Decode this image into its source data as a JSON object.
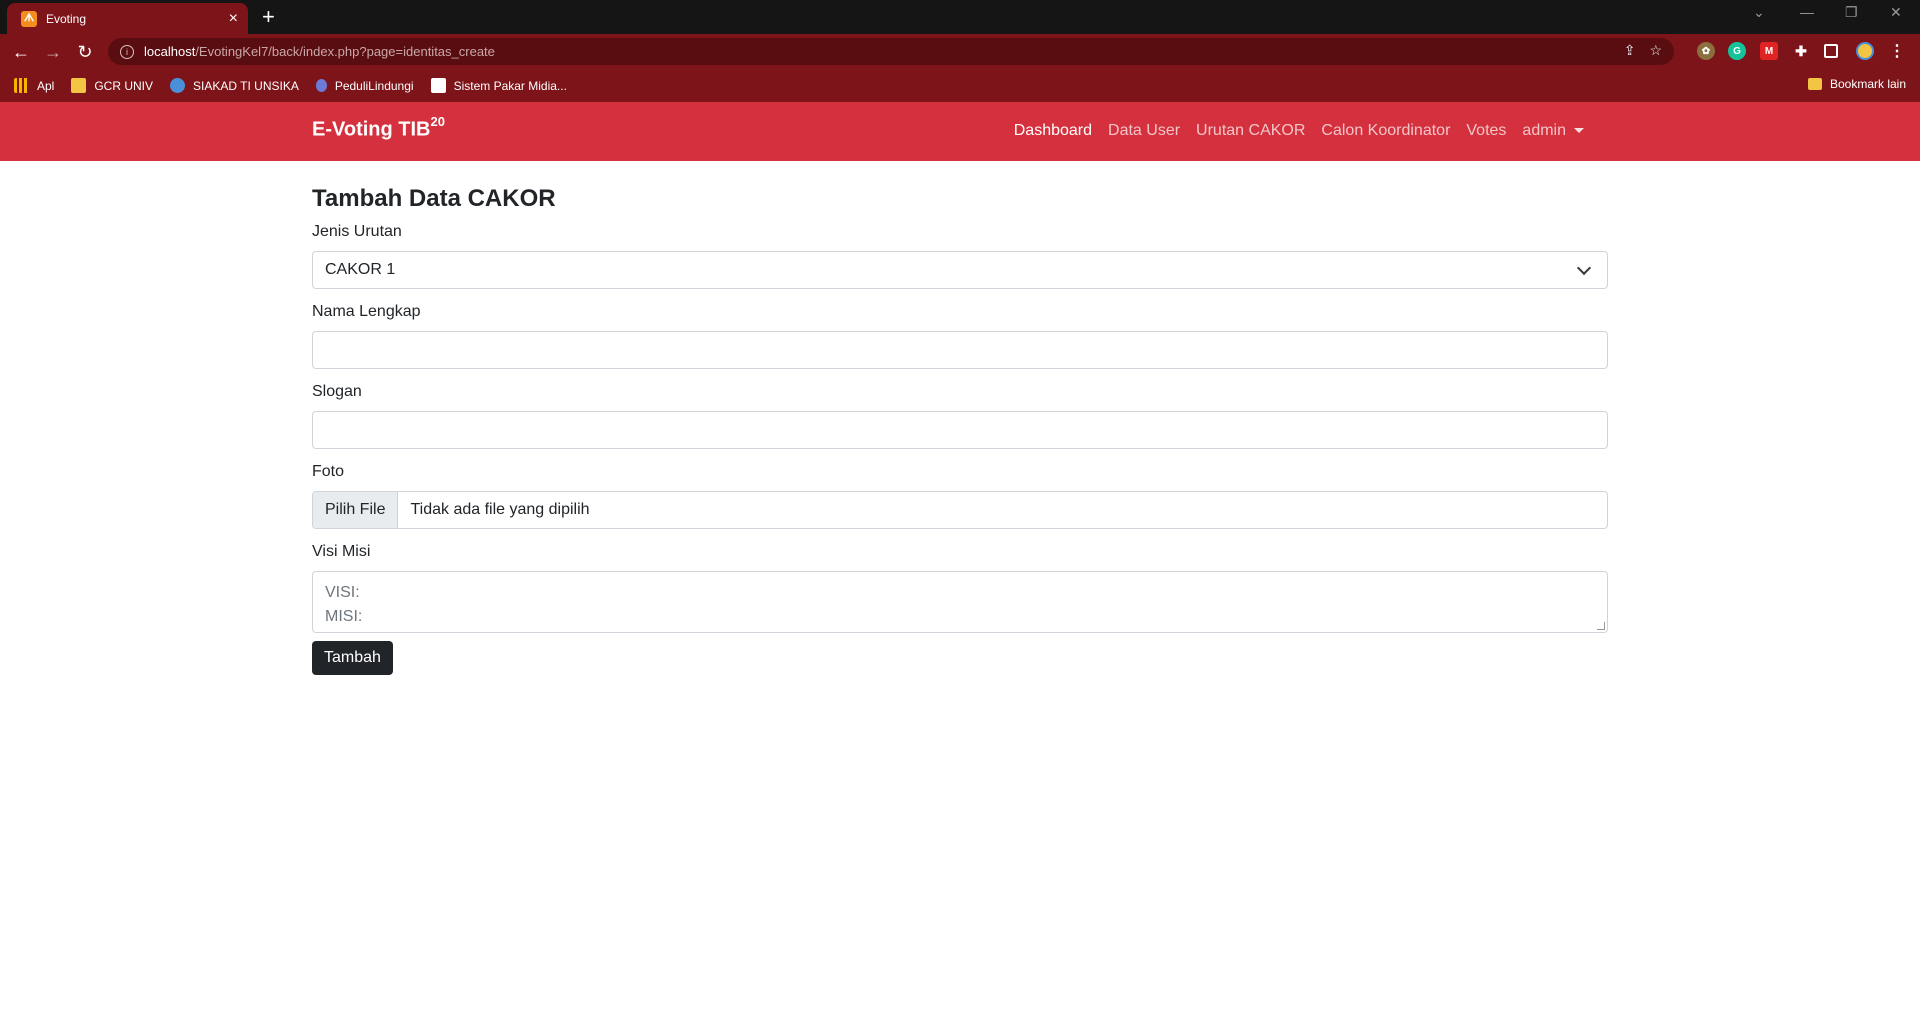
{
  "browser": {
    "tab_title": "Evoting",
    "tab_close": "×",
    "new_tab": "+",
    "url_host": "localhost",
    "url_path": "/EvotingKel7/back/index.php?page=identitas_create",
    "bookmarks": [
      {
        "label": "Apl",
        "icon": "apps-grid-icon",
        "color": "#f4b400"
      },
      {
        "label": "GCR UNIV",
        "icon": "classroom-icon",
        "color": "#f4c542"
      },
      {
        "label": "SIAKAD TI UNSIKA",
        "icon": "siakad-icon",
        "color": "#4a90d9"
      },
      {
        "label": "PeduliLindungi",
        "icon": "pedulilindungi-icon",
        "color": "#6b7bd6"
      },
      {
        "label": "Sistem Pakar Midia...",
        "icon": "pakar-icon",
        "color": "#ffffff"
      }
    ],
    "other_bookmarks": "Bookmark lain"
  },
  "navbar": {
    "brand": "E-Voting TIB",
    "brand_sup": "20",
    "links": [
      "Dashboard",
      "Data User",
      "Urutan CAKOR",
      "Calon Koordinator",
      "Votes"
    ],
    "user_menu": "admin"
  },
  "form": {
    "title": "Tambah Data CAKOR",
    "jenis_label": "Jenis Urutan",
    "jenis_value": "CAKOR 1",
    "nama_label": "Nama Lengkap",
    "nama_value": "",
    "slogan_label": "Slogan",
    "slogan_value": "",
    "foto_label": "Foto",
    "file_button": "Pilih File",
    "file_status": "Tidak ada file yang dipilih",
    "visi_label": "Visi Misi",
    "visi_placeholder_1": "VISI:",
    "visi_placeholder_2": "MISI:",
    "submit": "Tambah"
  },
  "colors": {
    "navbar": "#d4303d",
    "chrome": "#7d1419",
    "button": "#212529"
  }
}
